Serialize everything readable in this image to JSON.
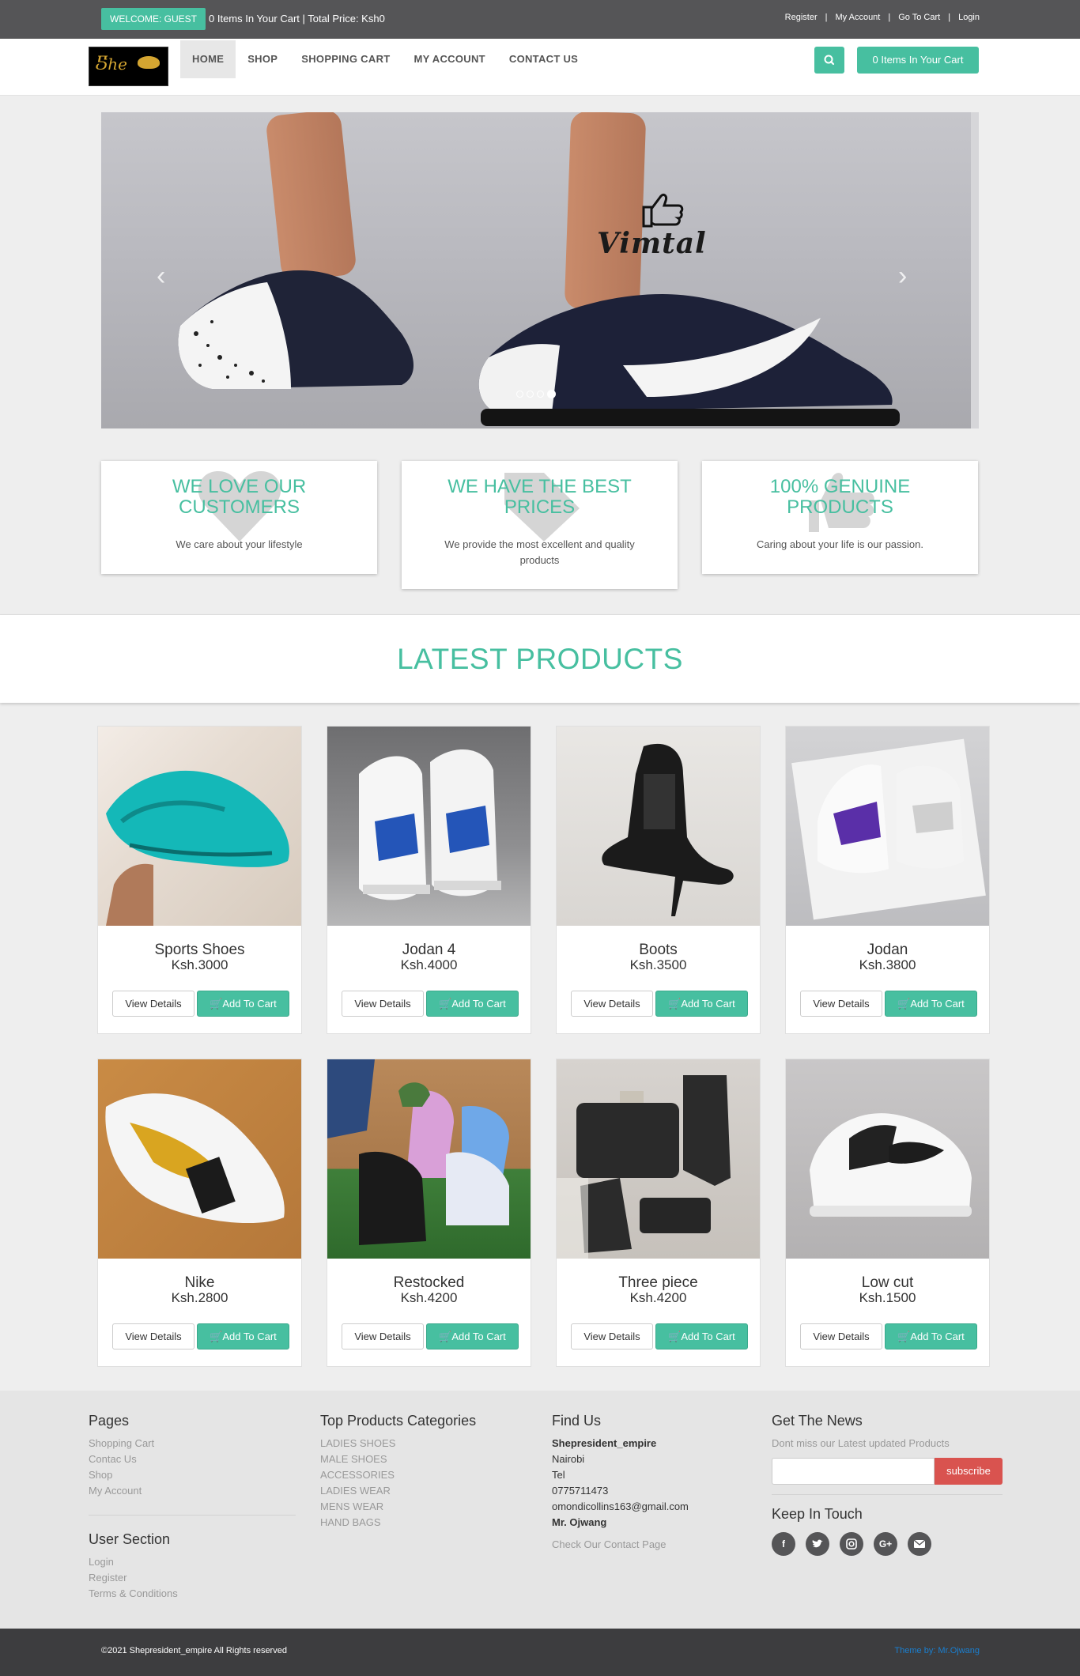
{
  "topbar": {
    "welcome": "WELCOME: GUEST",
    "cart_summary": "0 Items In Your Cart | Total Price: Ksh0",
    "links": [
      "Register",
      "My Account",
      "Go To Cart",
      "Login"
    ],
    "separator": "|"
  },
  "nav": {
    "items": [
      "HOME",
      "SHOP",
      "SHOPPING CART",
      "MY ACCOUNT",
      "CONTACT US"
    ],
    "cart_button": "0 Items In Your Cart"
  },
  "carousel": {
    "brand": "Vimtal",
    "slide_count": 4,
    "active_slide": 4
  },
  "features": [
    {
      "title": "WE LOVE OUR CUSTOMERS",
      "text": "We care about your lifestyle"
    },
    {
      "title": "WE HAVE THE BEST PRICES",
      "text": "We provide the most excellent and quality products"
    },
    {
      "title": "100% GENUINE PRODUCTS",
      "text": "Caring about your life is our passion."
    }
  ],
  "latest": {
    "title": "LATEST PRODUCTS",
    "view_label": "View Details",
    "add_label": "Add To Cart",
    "products": [
      {
        "name": "Sports Shoes",
        "price": "Ksh.3000"
      },
      {
        "name": "Jodan 4",
        "price": "Ksh.4000"
      },
      {
        "name": "Boots",
        "price": "Ksh.3500"
      },
      {
        "name": "Jodan",
        "price": "Ksh.3800"
      },
      {
        "name": "Nike",
        "price": "Ksh.2800"
      },
      {
        "name": "Restocked",
        "price": "Ksh.4200"
      },
      {
        "name": "Three piece",
        "price": "Ksh.4200"
      },
      {
        "name": "Low cut",
        "price": "Ksh.1500"
      }
    ]
  },
  "footer": {
    "pages_title": "Pages",
    "pages": [
      "Shopping Cart",
      "Contac Us",
      "Shop",
      "My Account"
    ],
    "user_title": "User Section",
    "user_links": [
      "Login",
      "Register",
      "Terms & Conditions"
    ],
    "categories_title": "Top Products Categories",
    "categories": [
      "LADIES SHOES",
      "MALE SHOES",
      "ACCESSORIES",
      "LADIES WEAR",
      "MENS WEAR",
      "HAND BAGS"
    ],
    "find_title": "Find Us",
    "find": {
      "company": "Shepresident_empire",
      "city": "Nairobi",
      "tel_label": "Tel",
      "phone": "0775711473",
      "email": "omondicollins163@gmail.com",
      "person": "Mr. Ojwang",
      "contact_link": "Check Our Contact Page"
    },
    "news_title": "Get The News",
    "news_text": "Dont miss our Latest updated Products",
    "subscribe": "subscribe",
    "touch_title": "Keep In Touch",
    "socials": [
      "facebook-icon",
      "twitter-icon",
      "instagram-icon",
      "google-plus-icon",
      "email-icon"
    ]
  },
  "bottom": {
    "copyright": "©2021 Shepresident_empire All Rights reserved",
    "theme": "Theme by: Mr.Ojwang"
  },
  "colors": {
    "accent": "#47bfa0",
    "topbar": "#555557",
    "subscribe": "#d9534f",
    "bottombar": "#3d3d3f"
  }
}
